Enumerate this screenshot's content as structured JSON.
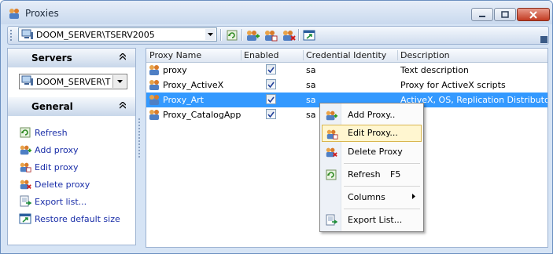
{
  "window": {
    "title": "Proxies"
  },
  "toolbar": {
    "server_value": "DOOM_SERVER\\TSERV2005"
  },
  "left": {
    "servers_header": "Servers",
    "server_select": "DOOM_SERVER\\T",
    "general_header": "General",
    "actions": [
      {
        "label": "Refresh",
        "icon": "refresh-icon"
      },
      {
        "label": "Add proxy",
        "icon": "add-proxy-icon"
      },
      {
        "label": "Edit proxy",
        "icon": "edit-proxy-icon"
      },
      {
        "label": "Delete proxy",
        "icon": "delete-proxy-icon"
      },
      {
        "label": "Export list...",
        "icon": "export-list-icon"
      },
      {
        "label": "Restore default size",
        "icon": "restore-size-icon"
      }
    ]
  },
  "grid": {
    "columns": [
      "Proxy Name",
      "Enabled",
      "Credential Identity",
      "Description"
    ],
    "rows": [
      {
        "name": "proxy",
        "enabled": true,
        "identity": "sa",
        "description": "Text description"
      },
      {
        "name": "Proxy_ActiveX",
        "enabled": true,
        "identity": "sa",
        "description": "Proxy for ActiveX scripts"
      },
      {
        "name": "Proxy_Art",
        "enabled": true,
        "identity": "sa",
        "description": "ActiveX, OS, Replication Distributor"
      },
      {
        "name": "Proxy_CatalogApp",
        "enabled": true,
        "identity": "sa",
        "description": ""
      }
    ],
    "selected_row": 2
  },
  "context_menu": {
    "items": [
      {
        "label": "Add Proxy..",
        "icon": "add-proxy-icon"
      },
      {
        "label": "Edit Proxy...",
        "icon": "edit-proxy-icon",
        "highlighted": true
      },
      {
        "label": "Delete Proxy",
        "icon": "delete-proxy-icon"
      },
      {
        "label": "Refresh",
        "shortcut": "F5",
        "icon": "refresh-icon"
      },
      {
        "label": "Columns",
        "submenu": true
      },
      {
        "label": "Export List...",
        "icon": "export-list-icon"
      }
    ]
  },
  "colors": {
    "selection": "#3399ff",
    "link": "#1a2ea8",
    "frame": "#d6e4f5"
  }
}
